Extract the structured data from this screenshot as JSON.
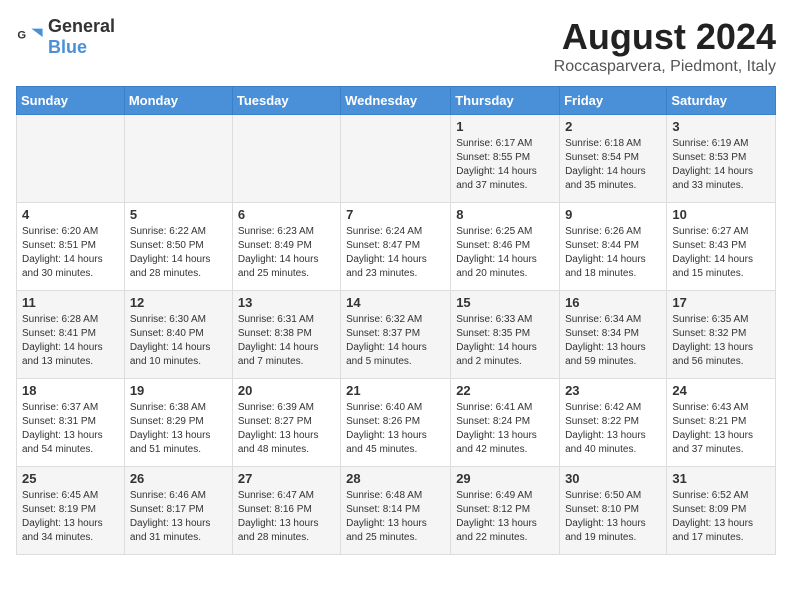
{
  "header": {
    "logo_general": "General",
    "logo_blue": "Blue",
    "month_title": "August 2024",
    "location": "Roccasparvera, Piedmont, Italy"
  },
  "weekdays": [
    "Sunday",
    "Monday",
    "Tuesday",
    "Wednesday",
    "Thursday",
    "Friday",
    "Saturday"
  ],
  "weeks": [
    [
      {
        "day": "",
        "info": ""
      },
      {
        "day": "",
        "info": ""
      },
      {
        "day": "",
        "info": ""
      },
      {
        "day": "",
        "info": ""
      },
      {
        "day": "1",
        "info": "Sunrise: 6:17 AM\nSunset: 8:55 PM\nDaylight: 14 hours and 37 minutes."
      },
      {
        "day": "2",
        "info": "Sunrise: 6:18 AM\nSunset: 8:54 PM\nDaylight: 14 hours and 35 minutes."
      },
      {
        "day": "3",
        "info": "Sunrise: 6:19 AM\nSunset: 8:53 PM\nDaylight: 14 hours and 33 minutes."
      }
    ],
    [
      {
        "day": "4",
        "info": "Sunrise: 6:20 AM\nSunset: 8:51 PM\nDaylight: 14 hours and 30 minutes."
      },
      {
        "day": "5",
        "info": "Sunrise: 6:22 AM\nSunset: 8:50 PM\nDaylight: 14 hours and 28 minutes."
      },
      {
        "day": "6",
        "info": "Sunrise: 6:23 AM\nSunset: 8:49 PM\nDaylight: 14 hours and 25 minutes."
      },
      {
        "day": "7",
        "info": "Sunrise: 6:24 AM\nSunset: 8:47 PM\nDaylight: 14 hours and 23 minutes."
      },
      {
        "day": "8",
        "info": "Sunrise: 6:25 AM\nSunset: 8:46 PM\nDaylight: 14 hours and 20 minutes."
      },
      {
        "day": "9",
        "info": "Sunrise: 6:26 AM\nSunset: 8:44 PM\nDaylight: 14 hours and 18 minutes."
      },
      {
        "day": "10",
        "info": "Sunrise: 6:27 AM\nSunset: 8:43 PM\nDaylight: 14 hours and 15 minutes."
      }
    ],
    [
      {
        "day": "11",
        "info": "Sunrise: 6:28 AM\nSunset: 8:41 PM\nDaylight: 14 hours and 13 minutes."
      },
      {
        "day": "12",
        "info": "Sunrise: 6:30 AM\nSunset: 8:40 PM\nDaylight: 14 hours and 10 minutes."
      },
      {
        "day": "13",
        "info": "Sunrise: 6:31 AM\nSunset: 8:38 PM\nDaylight: 14 hours and 7 minutes."
      },
      {
        "day": "14",
        "info": "Sunrise: 6:32 AM\nSunset: 8:37 PM\nDaylight: 14 hours and 5 minutes."
      },
      {
        "day": "15",
        "info": "Sunrise: 6:33 AM\nSunset: 8:35 PM\nDaylight: 14 hours and 2 minutes."
      },
      {
        "day": "16",
        "info": "Sunrise: 6:34 AM\nSunset: 8:34 PM\nDaylight: 13 hours and 59 minutes."
      },
      {
        "day": "17",
        "info": "Sunrise: 6:35 AM\nSunset: 8:32 PM\nDaylight: 13 hours and 56 minutes."
      }
    ],
    [
      {
        "day": "18",
        "info": "Sunrise: 6:37 AM\nSunset: 8:31 PM\nDaylight: 13 hours and 54 minutes."
      },
      {
        "day": "19",
        "info": "Sunrise: 6:38 AM\nSunset: 8:29 PM\nDaylight: 13 hours and 51 minutes."
      },
      {
        "day": "20",
        "info": "Sunrise: 6:39 AM\nSunset: 8:27 PM\nDaylight: 13 hours and 48 minutes."
      },
      {
        "day": "21",
        "info": "Sunrise: 6:40 AM\nSunset: 8:26 PM\nDaylight: 13 hours and 45 minutes."
      },
      {
        "day": "22",
        "info": "Sunrise: 6:41 AM\nSunset: 8:24 PM\nDaylight: 13 hours and 42 minutes."
      },
      {
        "day": "23",
        "info": "Sunrise: 6:42 AM\nSunset: 8:22 PM\nDaylight: 13 hours and 40 minutes."
      },
      {
        "day": "24",
        "info": "Sunrise: 6:43 AM\nSunset: 8:21 PM\nDaylight: 13 hours and 37 minutes."
      }
    ],
    [
      {
        "day": "25",
        "info": "Sunrise: 6:45 AM\nSunset: 8:19 PM\nDaylight: 13 hours and 34 minutes."
      },
      {
        "day": "26",
        "info": "Sunrise: 6:46 AM\nSunset: 8:17 PM\nDaylight: 13 hours and 31 minutes."
      },
      {
        "day": "27",
        "info": "Sunrise: 6:47 AM\nSunset: 8:16 PM\nDaylight: 13 hours and 28 minutes."
      },
      {
        "day": "28",
        "info": "Sunrise: 6:48 AM\nSunset: 8:14 PM\nDaylight: 13 hours and 25 minutes."
      },
      {
        "day": "29",
        "info": "Sunrise: 6:49 AM\nSunset: 8:12 PM\nDaylight: 13 hours and 22 minutes."
      },
      {
        "day": "30",
        "info": "Sunrise: 6:50 AM\nSunset: 8:10 PM\nDaylight: 13 hours and 19 minutes."
      },
      {
        "day": "31",
        "info": "Sunrise: 6:52 AM\nSunset: 8:09 PM\nDaylight: 13 hours and 17 minutes."
      }
    ]
  ]
}
